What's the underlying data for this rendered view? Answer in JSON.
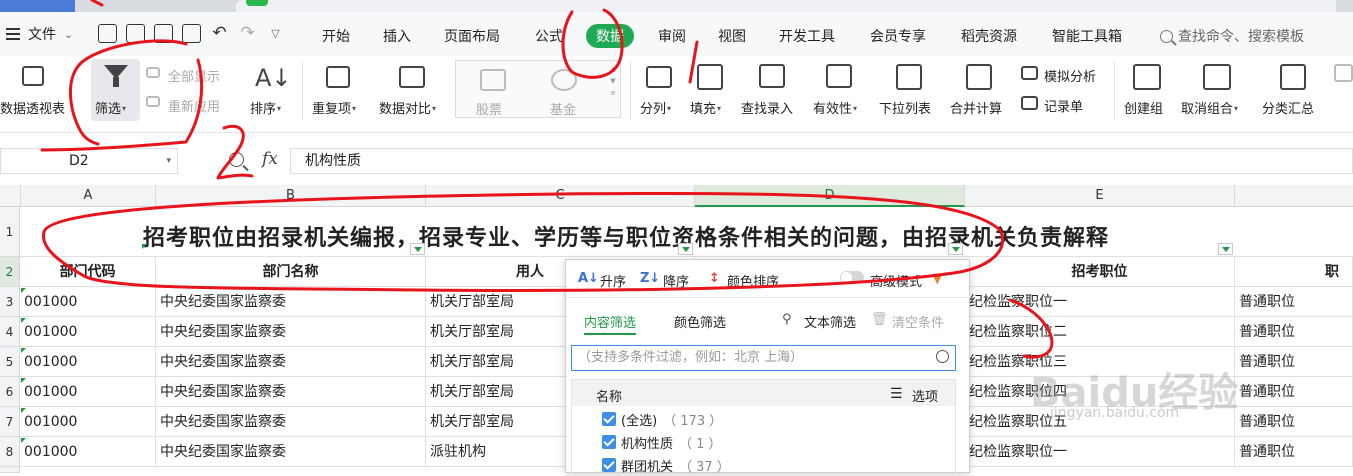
{
  "menu": {
    "file_label": "文件",
    "tabs": [
      "开始",
      "插入",
      "页面布局",
      "公式",
      "数据",
      "审阅",
      "视图",
      "开发工具",
      "会员专享",
      "稻壳资源",
      "智能工具箱"
    ],
    "active_tab": "数据",
    "search_placeholder": "查找命令、搜索模板"
  },
  "ribbon": {
    "pivot": "数据透视表",
    "filter": "筛选",
    "show_all": "全部显示",
    "reapply": "重新应用",
    "sort": "排序",
    "duplicates": "重复项",
    "compare": "数据对比",
    "stocks": "股票",
    "funds": "基金",
    "split": "分列",
    "fill": "填充",
    "lookup": "查找录入",
    "validity": "有效性",
    "dropdown_list": "下拉列表",
    "consolidate": "合并计算",
    "simulate": "模拟分析",
    "record_form": "记录单",
    "group": "创建组",
    "ungroup": "取消组合",
    "subtotal": "分类汇总"
  },
  "formula_bar": {
    "cell_ref": "D2",
    "fx": "fx",
    "content": "机构性质"
  },
  "columns": [
    "A",
    "B",
    "C",
    "D",
    "E"
  ],
  "selected_column": "D",
  "rows": [
    "1",
    "2",
    "3",
    "4",
    "5",
    "6",
    "7",
    "8"
  ],
  "title_row": "招考职位由招录机关编报，招录专业、学历等与职位资格条件相关的问题，由招录机关负责解释",
  "header_row": {
    "a": "部门代码",
    "b": "部门名称",
    "c": "用人",
    "e": "招考职位",
    "f": "职"
  },
  "data_rows": [
    {
      "a": "001000",
      "b": "中央纪委国家监察委",
      "c": "机关厅部室局",
      "e": "纪检监察职位一",
      "f": "普通职位"
    },
    {
      "a": "001000",
      "b": "中央纪委国家监察委",
      "c": "机关厅部室局",
      "e": "纪检监察职位二",
      "f": "普通职位"
    },
    {
      "a": "001000",
      "b": "中央纪委国家监察委",
      "c": "机关厅部室局",
      "e": "纪检监察职位三",
      "f": "普通职位"
    },
    {
      "a": "001000",
      "b": "中央纪委国家监察委",
      "c": "机关厅部室局",
      "e": "纪检监察职位四",
      "f": "普通职位"
    },
    {
      "a": "001000",
      "b": "中央纪委国家监察委",
      "c": "机关厅部室局",
      "e": "纪检监察职位五",
      "f": "普通职位"
    },
    {
      "a": "001000",
      "b": "中央纪委国家监察委",
      "c": "派驻机构",
      "e": "纪检监察职位一",
      "f": "普通职位"
    }
  ],
  "filter_panel": {
    "sort_asc": "升序",
    "sort_desc": "降序",
    "sort_color": "颜色排序",
    "advanced_mode": "高级模式",
    "tab_content": "内容筛选",
    "tab_color": "颜色筛选",
    "text_filter": "文本筛选",
    "clear_condition": "清空条件",
    "search_placeholder": "（支持多条件过滤，例如：北京 上海）",
    "list_header": "名称",
    "options_label": "选项",
    "items": [
      {
        "label": "(全选)",
        "count": "（ 173 ）"
      },
      {
        "label": "机构性质",
        "count": "（ 1 ）"
      },
      {
        "label": "群团机关",
        "count": "（ 37 ）"
      }
    ]
  },
  "watermark": {
    "brand": "Baidu经验",
    "url": "jingyan.baidu.com"
  },
  "colors": {
    "accent": "#1eaa55",
    "annotation": "#e8141b",
    "checkbox": "#3e8ee8"
  }
}
